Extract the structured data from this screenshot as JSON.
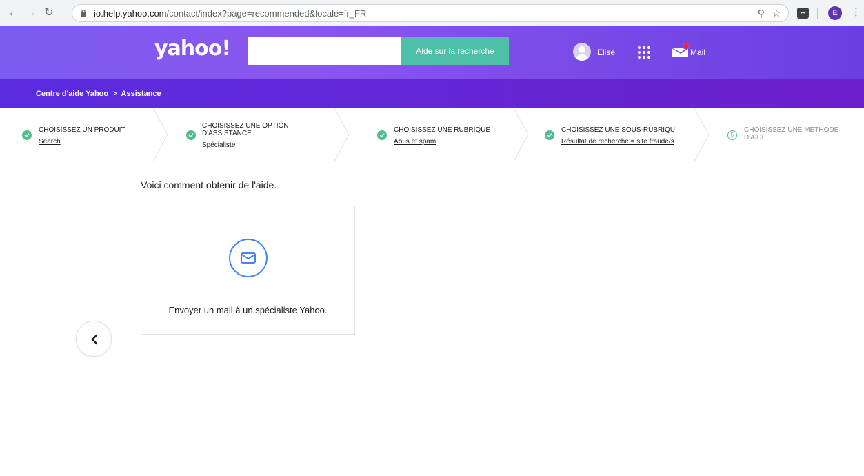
{
  "browser": {
    "url_host": "io.help.yahoo.com",
    "url_rest": "/contact/index?page=recommended&locale=fr_FR",
    "profile_initial": "E"
  },
  "header": {
    "logo": "yahoo!",
    "search_placeholder": "",
    "search_button": "Aide sur la recherche",
    "user_name": "Elise",
    "mail_label": "Mail"
  },
  "breadcrumb": {
    "home": "Centre d'aide Yahoo",
    "separator": ">",
    "current": "Assistance"
  },
  "steps": [
    {
      "title": "CHOISISSEZ UN PRODUIT",
      "title2": "",
      "value": "Search",
      "done": true
    },
    {
      "title": "CHOISISSEZ UNE OPTION",
      "title2": "D'ASSISTANCE",
      "value": "Spécialiste",
      "done": true
    },
    {
      "title": "CHOISISSEZ UNE RUBRIQUE",
      "title2": "",
      "value": "Abus et spam",
      "done": true
    },
    {
      "title": "CHOISISSEZ UNE SOUS-RUBRIQU",
      "title2": "",
      "value": "Résultat de recherche = site fraude/s",
      "done": true
    },
    {
      "title": "CHOISISSEZ UNE MÉTHODE",
      "title2": "D'AIDE",
      "value": "",
      "done": false,
      "number": "5"
    }
  ],
  "main": {
    "intro": "Voici comment obtenir de l'aide.",
    "card_text": "Envoyer un mail à un spécialiste Yahoo."
  },
  "colors": {
    "accent_green": "#4fc08d",
    "search_button": "#4fc0a8",
    "header_purple": "#7b5cf0",
    "crumb_purple": "#6327d6",
    "mail_blue": "#3d88f0"
  }
}
